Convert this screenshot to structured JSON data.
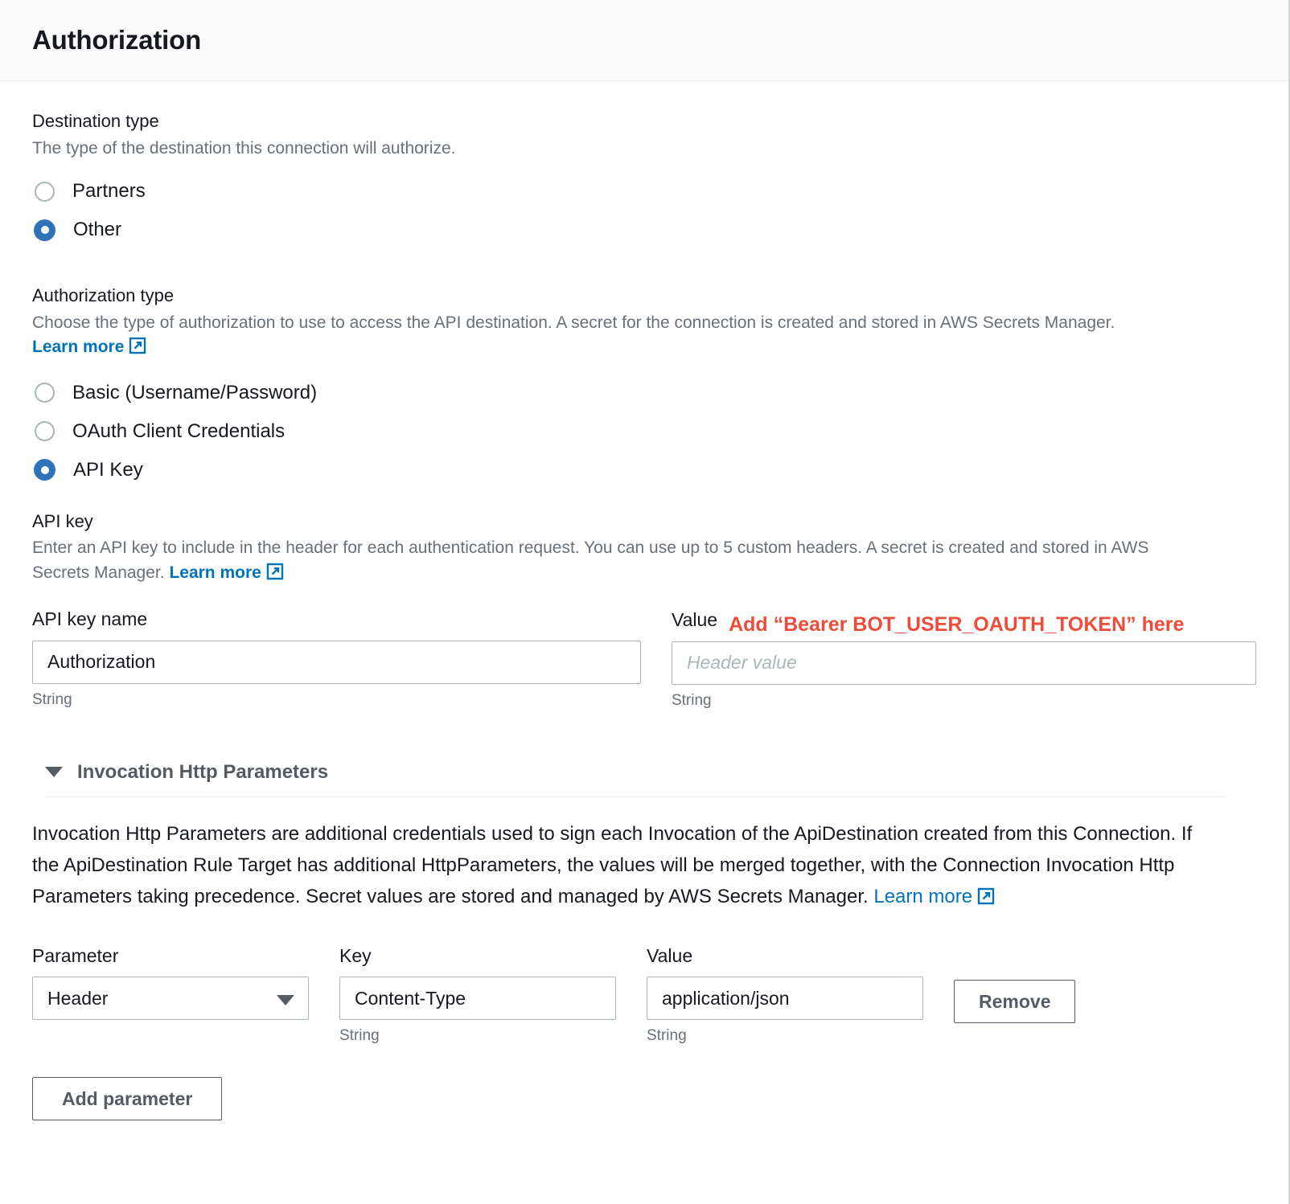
{
  "header": {
    "title": "Authorization"
  },
  "destination_type": {
    "label": "Destination type",
    "description": "The type of the destination this connection will authorize.",
    "options": [
      {
        "label": "Partners",
        "checked": false
      },
      {
        "label": "Other",
        "checked": true
      }
    ]
  },
  "authorization_type": {
    "label": "Authorization type",
    "description": "Choose the type of authorization to use to access the API destination. A secret for the connection is created and stored in AWS Secrets Manager.",
    "learn_more": "Learn more",
    "options": [
      {
        "label": "Basic (Username/Password)",
        "checked": false
      },
      {
        "label": "OAuth Client Credentials",
        "checked": false
      },
      {
        "label": "API Key",
        "checked": true
      }
    ]
  },
  "api_key": {
    "label": "API key",
    "description": "Enter an API key to include in the header for each authentication request. You can use up to 5 custom headers. A secret is created and stored in AWS Secrets Manager.",
    "learn_more": "Learn more",
    "name_label": "API key name",
    "name_value": "Authorization",
    "name_hint": "String",
    "value_label": "Value",
    "value_placeholder": "Header value",
    "value_value": "",
    "value_hint": "String",
    "annotation": "Add “Bearer BOT_USER_OAUTH_TOKEN” here"
  },
  "invocation_http_parameters": {
    "title": "Invocation Http Parameters",
    "expanded": true,
    "description": "Invocation Http Parameters are additional credentials used to sign each Invocation of the ApiDestination created from this Connection. If the ApiDestination Rule Target has additional HttpParameters, the values will be merged together, with the Connection Invocation Http Parameters taking precedence. Secret values are stored and managed by AWS Secrets Manager.",
    "learn_more": "Learn more",
    "columns": {
      "parameter": "Parameter",
      "key": "Key",
      "value": "Value"
    },
    "rows": [
      {
        "parameter": "Header",
        "key": "Content-Type",
        "key_hint": "String",
        "value": "application/json",
        "value_hint": "String",
        "remove_label": "Remove"
      }
    ],
    "add_parameter_label": "Add parameter"
  },
  "colors": {
    "accent_blue": "#2e72b8",
    "link_blue": "#0073bb",
    "annotation_red": "#ee4b3a",
    "border_gray": "#aab7b8",
    "text_secondary": "#687078",
    "header_bg": "#fafafa"
  }
}
